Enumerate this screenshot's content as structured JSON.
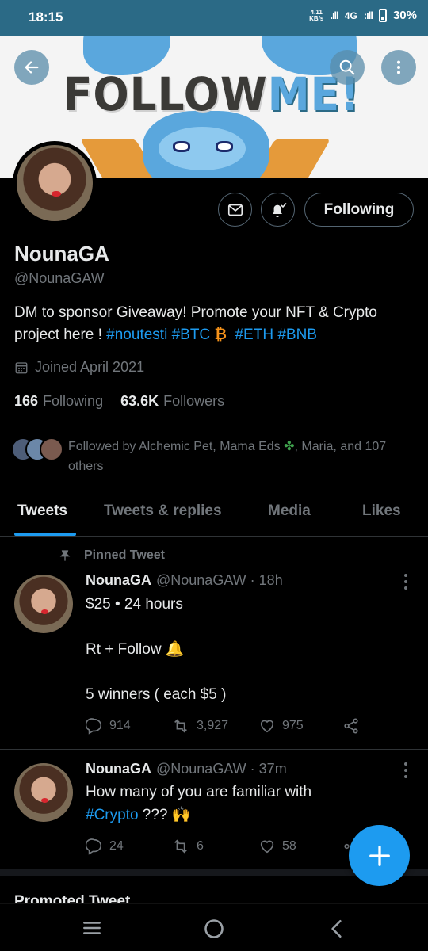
{
  "status_bar": {
    "time": "18:15",
    "speed_value": "4.11",
    "speed_unit": "KB/s",
    "network": "4G",
    "battery": "30%"
  },
  "banner": {
    "text_part1": "FOLLOW",
    "text_part2": "ME!"
  },
  "profile": {
    "name": "NounaGA",
    "handle": "@NounaGAW",
    "bio_text_1": "DM to sponsor Giveaway! Promote your NFT & Crypto project here ! ",
    "bio_tags": [
      "#noutesti",
      "#BTC",
      "#ETH",
      "#BNB"
    ],
    "btc_symbol": "₿",
    "joined": "Joined April 2021",
    "following_count": "166",
    "following_label": "Following",
    "followers_count": "63.6K",
    "followers_label": "Followers",
    "followed_by_prefix": "Followed by Alchemic Pet, Mama Eds ",
    "followed_by_emoji": "✤",
    "followed_by_suffix": ", Maria, and 107 others",
    "follow_button": "Following"
  },
  "tabs": [
    "Tweets",
    "Tweets & replies",
    "Media",
    "Likes"
  ],
  "active_tab": "Tweets",
  "tweets": [
    {
      "pinned_label": "Pinned Tweet",
      "author": "NounaGA",
      "handle": "@NounaGAW",
      "time": "· 18h",
      "line1": "$25 • 24 hours",
      "line2_text": "Rt + Follow ",
      "line2_emoji": "🔔",
      "line3": "5 winners ( each $5 )",
      "replies": "914",
      "retweets": "3,927",
      "likes": "975"
    },
    {
      "author": "NounaGA",
      "handle": "@NounaGAW",
      "time": "· 37m",
      "line1": "How many of you are familiar with",
      "hashtag": "#Crypto",
      "line2_rest": " ??? ",
      "line2_emoji": "🙌",
      "replies": "24",
      "retweets": "6",
      "likes": "58"
    }
  ],
  "promoted_label": "Promoted Tweet",
  "colors": {
    "accent": "#1d9bf0",
    "status_bar": "#2b6a86",
    "background": "#000000",
    "muted_text": "#71767b"
  }
}
